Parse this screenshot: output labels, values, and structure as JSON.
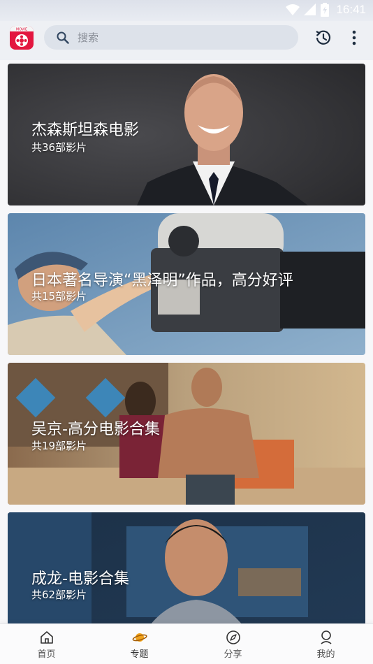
{
  "status_bar": {
    "time": "16:41"
  },
  "app": {
    "logo_text": "MOVIE"
  },
  "search": {
    "placeholder": "搜索"
  },
  "cards": [
    {
      "title": "杰森斯坦森电影",
      "count": "共36部影片"
    },
    {
      "title": "日本著名导演“黑泽明”作品，高分好评",
      "count": "共15部影片"
    },
    {
      "title": "吴京-高分电影合集",
      "count": "共19部影片"
    },
    {
      "title": "成龙-电影合集",
      "count": "共62部影片"
    }
  ],
  "bottom_nav": {
    "items": [
      {
        "label": "首页",
        "icon": "home-icon"
      },
      {
        "label": "专题",
        "icon": "planet-icon",
        "active": true
      },
      {
        "label": "分享",
        "icon": "compass-icon"
      },
      {
        "label": "我的",
        "icon": "profile-icon"
      }
    ]
  },
  "colors": {
    "brand": "#e3163f",
    "accent_icon": "#e08a12",
    "text_dark": "#333333"
  }
}
